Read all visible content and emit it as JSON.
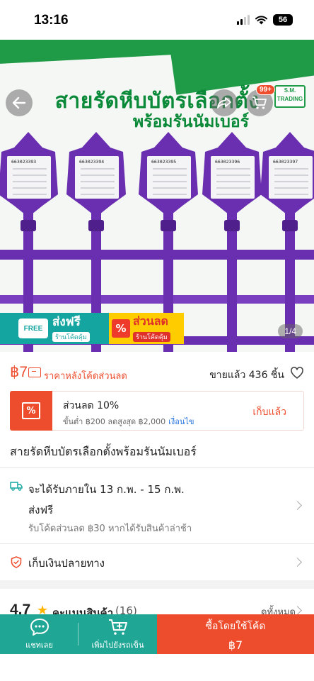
{
  "status_bar": {
    "time": "13:16",
    "battery": "56"
  },
  "hero": {
    "title": "สายรัดหีบบัตรเลือกตั้ง",
    "subtitle": "พร้อมรันนัมเบอร์",
    "tag_numbers": [
      "663023393",
      "663023394",
      "663023395",
      "663023396",
      "663023397"
    ],
    "cart_badge": "99+",
    "logo_text": "S.M. TRADING",
    "image_counter": "1/4",
    "promo_free": {
      "tag": "FREE",
      "main": "ส่งฟรี",
      "sub": "ร้านโค้ดคุ้ม"
    },
    "promo_discount": {
      "icon": "%",
      "main": "ส่วนลด",
      "sub": "ร้านโค้ดคุ้ม"
    },
    "accent_color": "#1f9a47",
    "strap_color": "#6a2fb0"
  },
  "price": {
    "value": "฿7",
    "note": "ราคาหลังโค้ดส่วนลด",
    "sold": "ขายแล้ว 436 ชิ้น"
  },
  "voucher": {
    "icon": "%",
    "title": "ส่วนลด 10%",
    "condition": "ขั้นต่ำ ฿200 ลดสูงสุด ฿2,000",
    "condition_link": "เงื่อนไข",
    "action": "เก็บแล้ว"
  },
  "product": {
    "title": "สายรัดหีบบัตรเลือกตั้งพร้อมรันนัมเบอร์"
  },
  "shipping": {
    "date": "จะได้รับภายใน 13 ก.พ. - 15 ก.พ.",
    "free": "ส่งฟรี",
    "late_note": "รับโค้ดส่วนลด ฿30 หากได้รับสินค้าล่าช้า"
  },
  "cod": {
    "label": "เก็บเงินปลายทาง"
  },
  "rating": {
    "score": "4.7",
    "label": "คะแนนสินค้า",
    "count": "(16)",
    "see_all": "ดูทั้งหมด"
  },
  "bottom_bar": {
    "chat_label": "แชทเลย",
    "cart_label": "เพิ่มไปยังรถเข็น",
    "buy_label": "ซื้อโดยใช้โค้ด",
    "buy_price": "฿7"
  },
  "colors": {
    "primary": "#ee4d2d",
    "teal": "#1fa695",
    "link": "#2673dd"
  }
}
